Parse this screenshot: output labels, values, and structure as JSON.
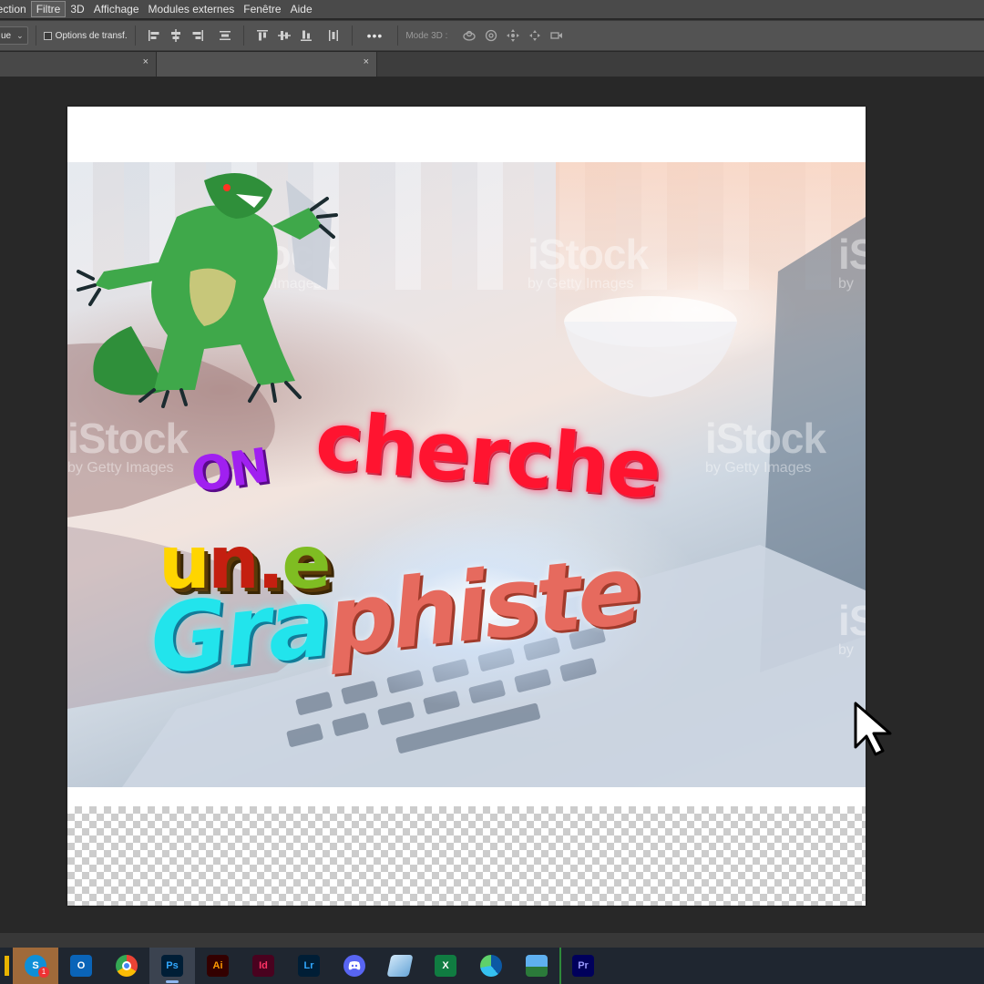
{
  "menu": {
    "items": [
      {
        "label": "lection",
        "active": false
      },
      {
        "label": "Filtre",
        "active": true
      },
      {
        "label": "3D",
        "active": false
      },
      {
        "label": "Affichage",
        "active": false
      },
      {
        "label": "Modules externes",
        "active": false
      },
      {
        "label": "Fenêtre",
        "active": false
      },
      {
        "label": "Aide",
        "active": false
      }
    ]
  },
  "options": {
    "dropdown_value": "ue",
    "transform_checkbox_label": "Options de transf.",
    "more_label": "•••",
    "mode3d_label": "Mode 3D :"
  },
  "tabs": [
    {
      "close": "×"
    },
    {
      "close": "×"
    }
  ],
  "canvas": {
    "headline": {
      "on": "ON",
      "cherche": "cherche",
      "une_1": "u",
      "une_2": "n.",
      "une_3": "e",
      "graphiste_1": "Gra",
      "graphiste_2": "phiste"
    },
    "watermarks": [
      {
        "main": "iStock",
        "sub": "by Getty Images"
      },
      {
        "main": "iStock",
        "sub": "by Getty Images"
      },
      {
        "main": "iStock",
        "sub": "by Getty Images"
      },
      {
        "main": "iStock",
        "sub": "by Getty Images"
      },
      {
        "main": "iSt",
        "sub": "by"
      },
      {
        "main": "iS",
        "sub": "by"
      }
    ]
  },
  "taskbar": {
    "apps": [
      {
        "name": "skype",
        "label": "S",
        "badge": "1",
        "bg": "#0f8fd8",
        "fg": "#ffffff"
      },
      {
        "name": "outlook",
        "label": "O",
        "bg": "#0a64b8",
        "fg": "#ffffff"
      },
      {
        "name": "chrome",
        "label": "",
        "bg": "#ffffff",
        "fg": "#000000"
      },
      {
        "name": "photoshop",
        "label": "Ps",
        "bg": "#001e36",
        "fg": "#31a8ff"
      },
      {
        "name": "illustrator",
        "label": "Ai",
        "bg": "#330000",
        "fg": "#ff9a00"
      },
      {
        "name": "indesign",
        "label": "Id",
        "bg": "#49021f",
        "fg": "#ff3366"
      },
      {
        "name": "lightroom",
        "label": "Lr",
        "bg": "#001e36",
        "fg": "#31a8ff"
      },
      {
        "name": "discord",
        "label": "",
        "bg": "#5865f2",
        "fg": "#ffffff"
      },
      {
        "name": "notes",
        "label": "",
        "bg": "#9fc8e8",
        "fg": "#ffffff"
      },
      {
        "name": "excel",
        "label": "X",
        "bg": "#107c41",
        "fg": "#ffffff"
      },
      {
        "name": "edge",
        "label": "",
        "bg": "#1aa5c8",
        "fg": "#ffffff"
      },
      {
        "name": "photos",
        "label": "",
        "bg": "#2d86d8",
        "fg": "#ffffff"
      },
      {
        "name": "premiere",
        "label": "Pr",
        "bg": "#00005b",
        "fg": "#9999ff"
      }
    ]
  }
}
